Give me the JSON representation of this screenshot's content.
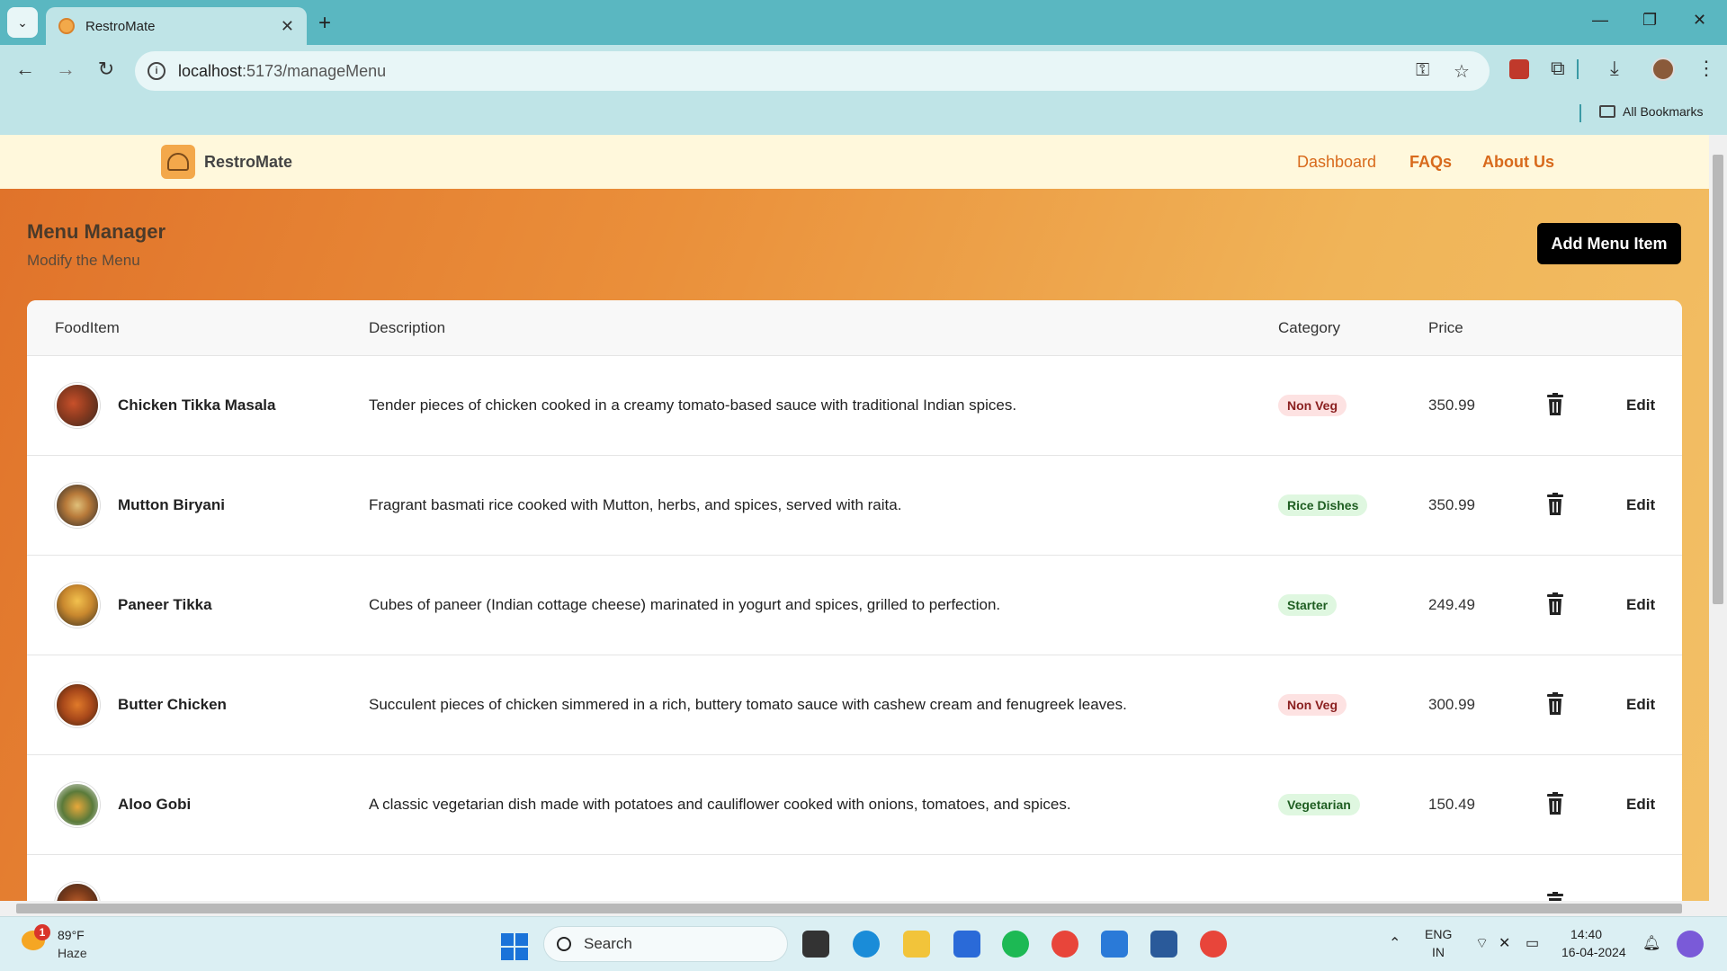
{
  "browser": {
    "tab_title": "RestroMate",
    "url_host": "localhost",
    "url_path": ":5173/manageMenu",
    "bookmarks_label": "All Bookmarks"
  },
  "site": {
    "brand": "RestroMate",
    "nav": [
      "Dashboard",
      "FAQs",
      "About Us"
    ]
  },
  "page": {
    "title": "Menu Manager",
    "subtitle": "Modify the Menu",
    "add_button": "Add Menu Item"
  },
  "table": {
    "headers": [
      "FoodItem",
      "Description",
      "Category",
      "Price"
    ],
    "rows": [
      {
        "name": "Chicken Tikka Masala",
        "description": "Tender pieces of chicken cooked in a creamy tomato-based sauce with traditional Indian spices.",
        "category": "Non Veg",
        "price": "350.99",
        "edit": "Edit"
      },
      {
        "name": "Mutton Biryani",
        "description": "Fragrant basmati rice cooked with Mutton, herbs, and spices, served with raita.",
        "category": "Rice Dishes",
        "price": "350.99",
        "edit": "Edit"
      },
      {
        "name": "Paneer Tikka",
        "description": "Cubes of paneer (Indian cottage cheese) marinated in yogurt and spices, grilled to perfection.",
        "category": "Starter",
        "price": "249.49",
        "edit": "Edit"
      },
      {
        "name": "Butter Chicken",
        "description": "Succulent pieces of chicken simmered in a rich, buttery tomato sauce with cashew cream and fenugreek leaves.",
        "category": "Non Veg",
        "price": "300.99",
        "edit": "Edit"
      },
      {
        "name": "Aloo Gobi",
        "description": "A classic vegetarian dish made with potatoes and cauliflower cooked with onions, tomatoes, and spices.",
        "category": "Vegetarian",
        "price": "150.49",
        "edit": "Edit"
      }
    ]
  },
  "taskbar": {
    "weather_temp": "89°F",
    "weather_cond": "Haze",
    "weather_badge": "1",
    "search_label": "Search",
    "lang_top": "ENG",
    "lang_bottom": "IN",
    "time": "14:40",
    "date": "16-04-2024"
  },
  "colors": {
    "accent": "#d86a1c",
    "header_bg": "#fff8dc",
    "badge_red_bg": "#fde2e2",
    "badge_green_bg": "#dff7e0"
  }
}
